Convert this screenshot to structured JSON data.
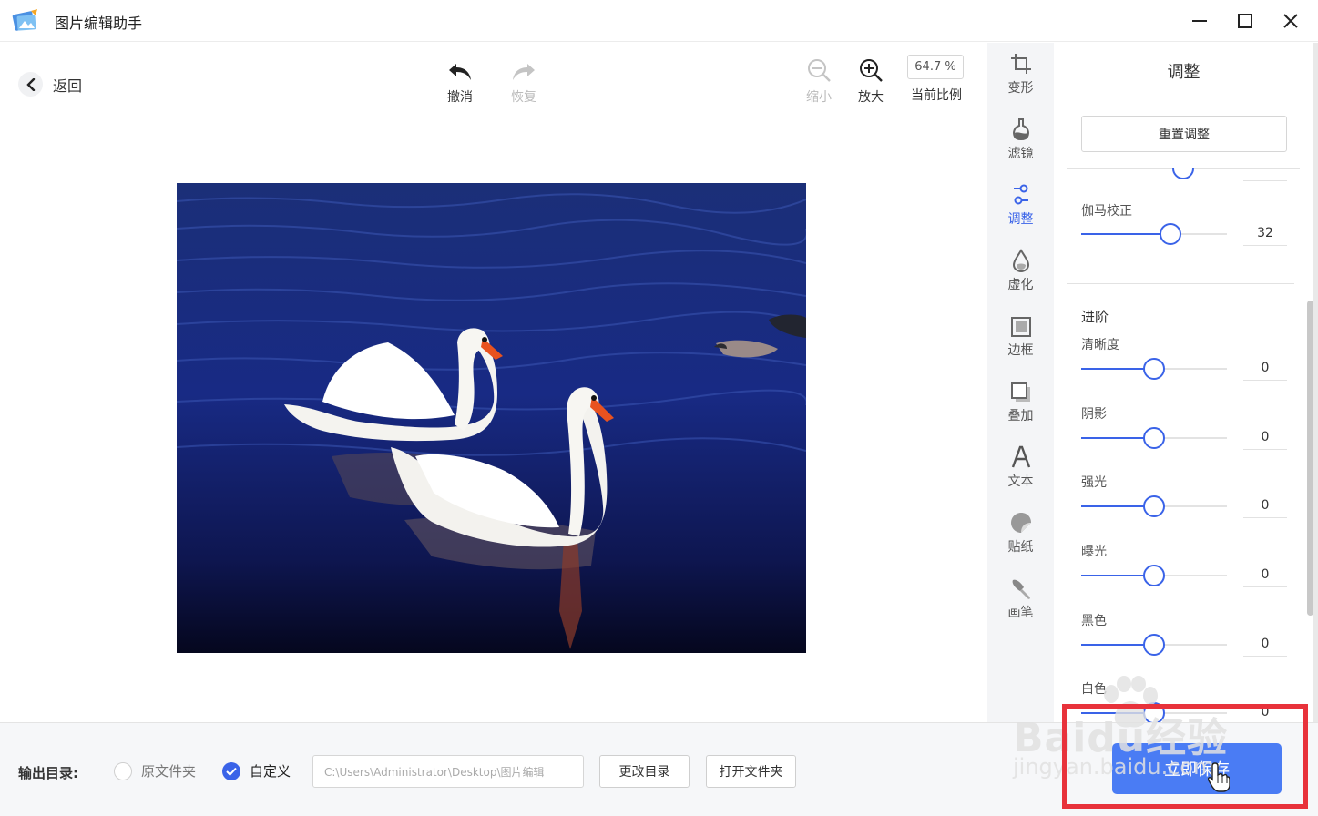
{
  "window": {
    "title": "图片编辑助手"
  },
  "toolbar": {
    "back_label": "返回",
    "undo_label": "撤消",
    "redo_label": "恢复",
    "zoom_out_label": "缩小",
    "zoom_in_label": "放大",
    "zoom_value": "64.7 %",
    "zoom_ratio_label": "当前比例"
  },
  "tool_strip": {
    "items": [
      {
        "label": "变形",
        "icon": "crop-icon"
      },
      {
        "label": "滤镜",
        "icon": "flask-icon"
      },
      {
        "label": "调整",
        "icon": "adjust-sliders-icon",
        "active": true
      },
      {
        "label": "虚化",
        "icon": "blur-drop-icon"
      },
      {
        "label": "边框",
        "icon": "frame-icon"
      },
      {
        "label": "叠加",
        "icon": "overlay-icon"
      },
      {
        "label": "文本",
        "icon": "text-icon"
      },
      {
        "label": "贴纸",
        "icon": "sticker-icon"
      },
      {
        "label": "画笔",
        "icon": "brush-icon"
      }
    ]
  },
  "panel": {
    "title": "调整",
    "reset_label": "重置调整",
    "gamma": {
      "label": "伽马校正",
      "value": "32",
      "level": 0.63
    },
    "advanced_title": "进阶",
    "advanced": [
      {
        "label": "清晰度",
        "value": "0",
        "level": 0.5
      },
      {
        "label": "阴影",
        "value": "0",
        "level": 0.5
      },
      {
        "label": "强光",
        "value": "0",
        "level": 0.5
      },
      {
        "label": "曝光",
        "value": "0",
        "level": 0.5
      },
      {
        "label": "黑色",
        "value": "0",
        "level": 0.5
      },
      {
        "label": "白色",
        "value": "0",
        "level": 0.5
      }
    ]
  },
  "bottom": {
    "output_label": "输出目录:",
    "radio_original": "原文件夹",
    "radio_custom": "自定义",
    "path_value": "C:\\Users\\Administrator\\Desktop\\图片编辑",
    "change_dir_label": "更改目录",
    "open_folder_label": "打开文件夹",
    "save_label": "立即保存"
  },
  "watermark": {
    "brand": "Baidu经验",
    "url": "jingyan.baidu.com"
  },
  "colors": {
    "accent": "#3a63e8",
    "save_button": "#4a7cf4",
    "highlight": "#e8323b"
  }
}
